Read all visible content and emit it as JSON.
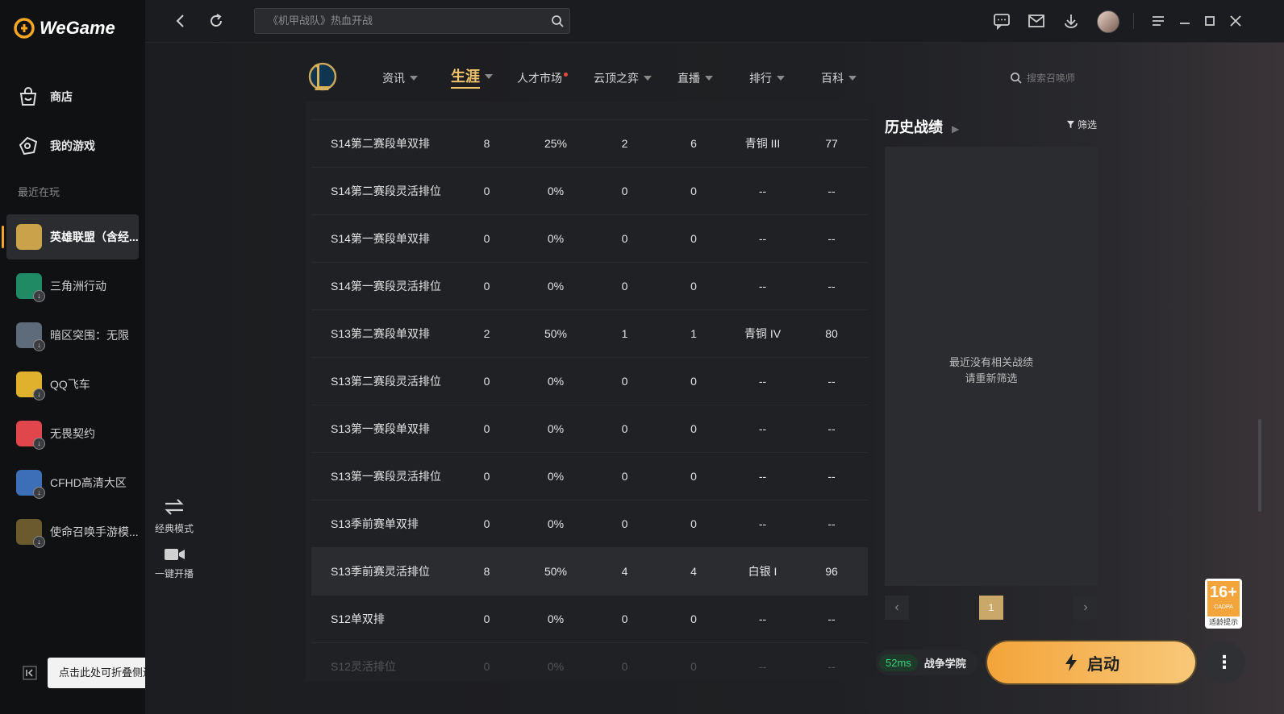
{
  "app": {
    "name": "WeGame"
  },
  "sidebar": {
    "nav": [
      {
        "label": "商店",
        "icon": "shop-bag-icon"
      },
      {
        "label": "我的游戏",
        "icon": "gamepad-tag-icon"
      }
    ],
    "recent_label": "最近在玩",
    "games": [
      {
        "label": "英雄联盟（含经...",
        "color": "#c9a24a",
        "active": true
      },
      {
        "label": "三角洲行动",
        "color": "#1f8a63"
      },
      {
        "label": "暗区突围：无限",
        "color": "#5d6b7a"
      },
      {
        "label": "QQ飞车",
        "color": "#e0b12c"
      },
      {
        "label": "无畏契约",
        "color": "#e0464b"
      },
      {
        "label": "CFHD高清大区",
        "color": "#3d6fb8"
      },
      {
        "label": "使命召唤手游模...",
        "color": "#6b5a2e"
      }
    ],
    "collapse_tooltip": "点击此处可折叠侧边栏"
  },
  "topbar": {
    "search_placeholder": "《机甲战队》热血开战"
  },
  "tabs": [
    {
      "label": "资讯",
      "caret": true
    },
    {
      "label": "生涯",
      "caret": true,
      "active": true
    },
    {
      "label": "人才市场",
      "caret": false,
      "dot": true
    },
    {
      "label": "云顶之弈",
      "caret": true
    },
    {
      "label": "直播",
      "caret": true
    },
    {
      "label": "排行",
      "caret": true
    },
    {
      "label": "百科",
      "caret": true
    }
  ],
  "summoner_search_placeholder": "搜索召唤师",
  "side_buttons": {
    "classic_mode": "经典模式",
    "one_click_stream": "一键开播"
  },
  "table": {
    "rows": [
      [
        "S14第二赛段单双排",
        "8",
        "25%",
        "2",
        "6",
        "青铜 III",
        "77"
      ],
      [
        "S14第二赛段灵活排位",
        "0",
        "0%",
        "0",
        "0",
        "--",
        "--"
      ],
      [
        "S14第一赛段单双排",
        "0",
        "0%",
        "0",
        "0",
        "--",
        "--"
      ],
      [
        "S14第一赛段灵活排位",
        "0",
        "0%",
        "0",
        "0",
        "--",
        "--"
      ],
      [
        "S13第二赛段单双排",
        "2",
        "50%",
        "1",
        "1",
        "青铜 IV",
        "80"
      ],
      [
        "S13第二赛段灵活排位",
        "0",
        "0%",
        "0",
        "0",
        "--",
        "--"
      ],
      [
        "S13第一赛段单双排",
        "0",
        "0%",
        "0",
        "0",
        "--",
        "--"
      ],
      [
        "S13第一赛段灵活排位",
        "0",
        "0%",
        "0",
        "0",
        "--",
        "--"
      ],
      [
        "S13季前赛单双排",
        "0",
        "0%",
        "0",
        "0",
        "--",
        "--"
      ],
      [
        "S13季前赛灵活排位",
        "8",
        "50%",
        "4",
        "4",
        "白银 I",
        "96"
      ],
      [
        "S12单双排",
        "0",
        "0%",
        "0",
        "0",
        "--",
        "--"
      ],
      [
        "S12灵活排位",
        "0",
        "0%",
        "0",
        "0",
        "--",
        "--"
      ]
    ],
    "highlight_row": 9
  },
  "history": {
    "title": "历史战绩",
    "filter_label": "筛选",
    "empty_line1": "最近没有相关战绩",
    "empty_line2": "请重新筛选",
    "page": "1"
  },
  "bottom": {
    "latency": "52ms",
    "academy": "战争学院",
    "launch": "启动",
    "rating": "16+",
    "rating_org": "CADPA",
    "rating_note": "适龄提示"
  }
}
